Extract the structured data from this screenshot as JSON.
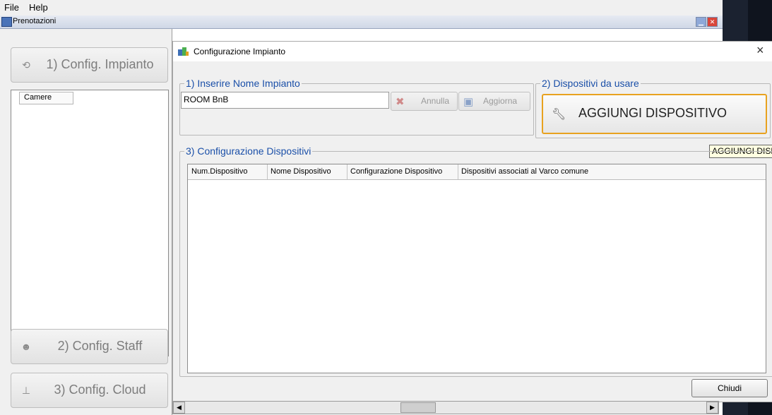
{
  "menubar": {
    "items": [
      "File",
      "Help"
    ]
  },
  "window": {
    "title": "Prenotazioni"
  },
  "sidebar": {
    "buttons": [
      {
        "label": "1) Config. Impianto",
        "icon": "refresh-icon"
      },
      {
        "label": "2) Config. Staff",
        "icon": "people-icon"
      },
      {
        "label": "3) Config. Cloud",
        "icon": "network-icon"
      }
    ],
    "camere_header": "Camere"
  },
  "dialog": {
    "title": "Configurazione Impianto",
    "close_glyph": "×",
    "group1": {
      "legend": "1) Inserire Nome Impianto",
      "name_value": "ROOM BnB",
      "annulla_label": "Annulla",
      "aggiorna_label": "Aggiorna"
    },
    "group2": {
      "legend": "2) Dispositivi da usare",
      "add_button_label": "AGGIUNGI DISPOSITIVO",
      "tooltip": "AGGIUNGI DISPOSITIVO"
    },
    "group3": {
      "legend": "3) Configurazione Dispositivi",
      "columns": [
        "Num.Dispositivo",
        "Nome Dispositivo",
        "Configurazione Dispositivo",
        "Dispositivi associati al Varco comune"
      ]
    },
    "close_button_label": "Chiudi"
  },
  "colors": {
    "legend_blue": "#1a4fa8",
    "accent_orange": "#e8a21f",
    "tooltip_bg": "#ffffe1"
  }
}
